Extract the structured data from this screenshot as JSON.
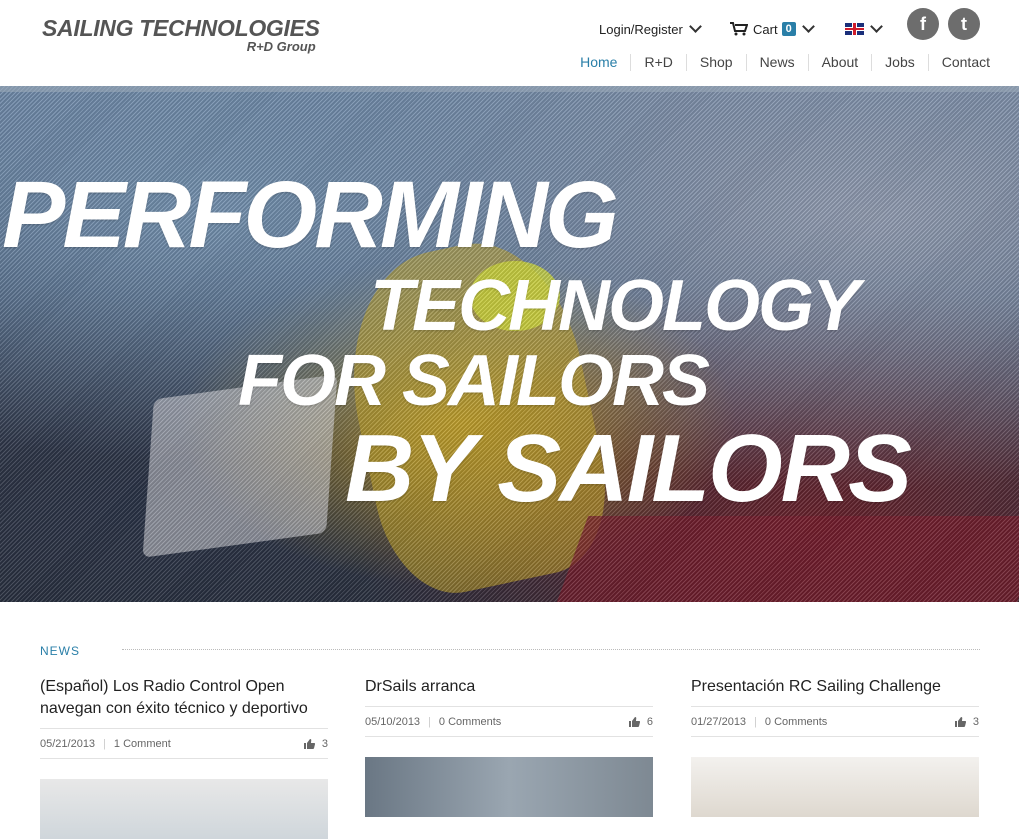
{
  "brand": {
    "name": "SAILING TECHNOLOGIES",
    "subtitle": "R+D Group"
  },
  "topbar": {
    "login_label": "Login/Register",
    "cart_label": "Cart",
    "cart_count": "0",
    "language": "English (UK flag)",
    "social": {
      "facebook": "f",
      "twitter": "t"
    }
  },
  "nav": {
    "items": [
      "Home",
      "R+D",
      "Shop",
      "News",
      "About",
      "Jobs",
      "Contact"
    ],
    "active": "Home"
  },
  "hero": {
    "line1": "PERFORMING",
    "line2": "TECHNOLOGY",
    "line3": "FOR SAILORS",
    "line4": "BY SAILORS"
  },
  "news": {
    "heading": "NEWS",
    "posts": [
      {
        "title": "(Español) Los Radio Control Open navegan con éxito técnico y deportivo",
        "date": "05/21/2013",
        "comments": "1 Comment",
        "likes": "3"
      },
      {
        "title": "DrSails arranca",
        "date": "05/10/2013",
        "comments": "0 Comments",
        "likes": "6"
      },
      {
        "title": "Presentación RC Sailing Challenge",
        "date": "01/27/2013",
        "comments": "0 Comments",
        "likes": "3"
      }
    ]
  },
  "colors": {
    "accent": "#2a7fa8",
    "social_bg": "#6d6d6d"
  }
}
